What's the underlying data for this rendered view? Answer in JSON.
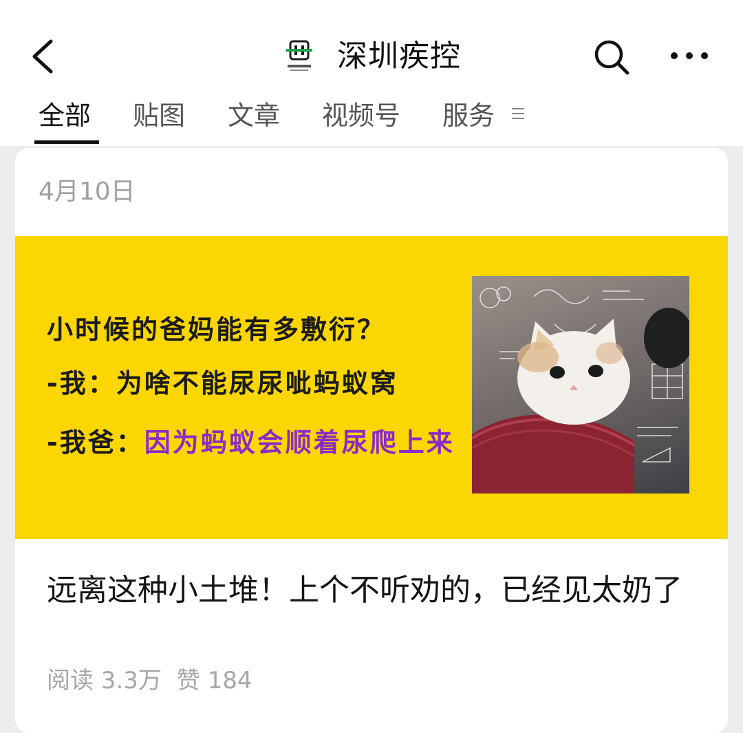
{
  "header": {
    "title": "深圳疾控",
    "logo_text": "深圳疾控",
    "back_icon": "chevron-left-icon",
    "search_icon": "search-icon",
    "more_icon": "more-dots-icon"
  },
  "tabs": [
    {
      "label": "全部",
      "active": true
    },
    {
      "label": "贴图",
      "active": false
    },
    {
      "label": "文章",
      "active": false
    },
    {
      "label": "视频号",
      "active": false
    },
    {
      "label": "服务",
      "active": false
    }
  ],
  "tab_menu_icon": "menu-lines-icon",
  "post": {
    "date": "4月10日",
    "cover": {
      "background_color": "#fbd600",
      "line1": "小时候的爸妈能有多敷衍？",
      "line2": "-我：为啥不能尿尿呲蚂蚁窝",
      "line3_prefix": "-我爸：",
      "line3_highlight": "因为蚂蚁会顺着尿爬上来",
      "highlight_color": "#8a2bc6",
      "image": "thinking-cat-math-meme"
    },
    "headline": "远离这种小土堆！上个不听劝的，已经见太奶了",
    "reads": "阅读 3.3万",
    "likes": "赞 184"
  }
}
